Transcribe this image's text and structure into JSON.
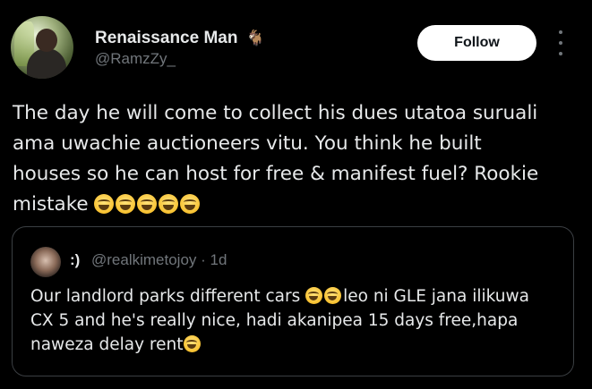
{
  "author": {
    "name": "Renaissance Man",
    "badge_emoji": "🐐",
    "handle": "@RamzZy_"
  },
  "follow_label": "Follow",
  "more_icon": "more-vertical-icon",
  "tweet": {
    "line1": "The day he will come to collect his dues utatoa suruali",
    "line2": "ama uwachie auctioneers vitu. You think he built",
    "line3": "houses so he can host for free & manifest fuel? Rookie",
    "line4": "mistake"
  },
  "quoted": {
    "name": ":)",
    "handle": "@realkimetojoy",
    "separator": " · ",
    "time": "1d",
    "line1_a": "Our landlord parks different cars ",
    "line1_b": "leo ni GLE jana ilikuwa",
    "line2": "CX 5 and he's really nice, hadi akanipea 15 days free,hapa",
    "line3": "naweza delay rent"
  },
  "colors": {
    "background": "#000000",
    "text": "#e7e9ea",
    "secondary": "#71767b",
    "border": "#3b3f43",
    "follow_bg": "#ffffff"
  }
}
